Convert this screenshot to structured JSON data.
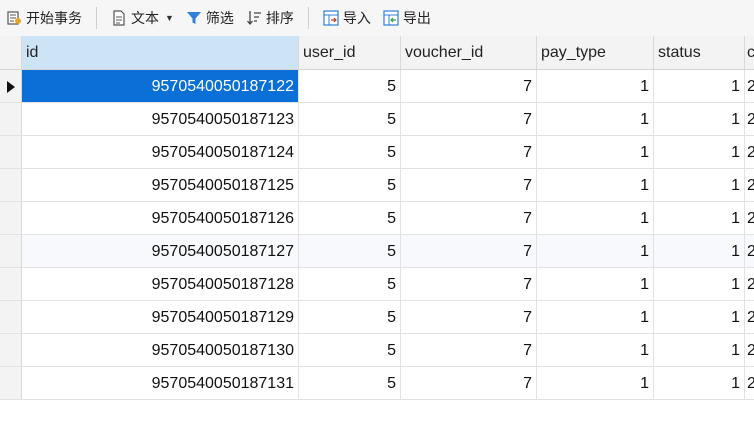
{
  "toolbar": {
    "begin_transaction": "开始事务",
    "text": "文本",
    "filter": "筛选",
    "sort": "排序",
    "import": "导入",
    "export": "导出"
  },
  "columns": [
    "id",
    "user_id",
    "voucher_id",
    "pay_type",
    "status",
    "c"
  ],
  "rows": [
    {
      "id": "9570540050187122",
      "user_id": "5",
      "voucher_id": "7",
      "pay_type": "1",
      "status": "1",
      "extra": "2"
    },
    {
      "id": "9570540050187123",
      "user_id": "5",
      "voucher_id": "7",
      "pay_type": "1",
      "status": "1",
      "extra": "2"
    },
    {
      "id": "9570540050187124",
      "user_id": "5",
      "voucher_id": "7",
      "pay_type": "1",
      "status": "1",
      "extra": "2"
    },
    {
      "id": "9570540050187125",
      "user_id": "5",
      "voucher_id": "7",
      "pay_type": "1",
      "status": "1",
      "extra": "2"
    },
    {
      "id": "9570540050187126",
      "user_id": "5",
      "voucher_id": "7",
      "pay_type": "1",
      "status": "1",
      "extra": "2"
    },
    {
      "id": "9570540050187127",
      "user_id": "5",
      "voucher_id": "7",
      "pay_type": "1",
      "status": "1",
      "extra": "2"
    },
    {
      "id": "9570540050187128",
      "user_id": "5",
      "voucher_id": "7",
      "pay_type": "1",
      "status": "1",
      "extra": "2"
    },
    {
      "id": "9570540050187129",
      "user_id": "5",
      "voucher_id": "7",
      "pay_type": "1",
      "status": "1",
      "extra": "2"
    },
    {
      "id": "9570540050187130",
      "user_id": "5",
      "voucher_id": "7",
      "pay_type": "1",
      "status": "1",
      "extra": "2"
    },
    {
      "id": "9570540050187131",
      "user_id": "5",
      "voucher_id": "7",
      "pay_type": "1",
      "status": "1",
      "extra": "2"
    }
  ],
  "colors": {
    "selection": "#0a6fd6",
    "filter_icon": "#2f7fd8",
    "import_icon": "#2f7fd8"
  },
  "icons": [
    "transaction-icon",
    "text-icon",
    "filter-icon",
    "sort-icon",
    "import-icon",
    "export-icon"
  ]
}
